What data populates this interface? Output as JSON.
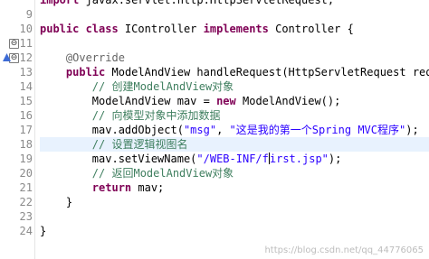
{
  "editor": {
    "line_numbers": [
      "9",
      "10",
      "11",
      "12",
      "13",
      "14",
      "15",
      "16",
      "17",
      "18",
      "19",
      "20",
      "21",
      "22",
      "23",
      "24"
    ],
    "lines": [
      [
        {
          "c": "kw",
          "t": "import"
        },
        {
          "c": "",
          "t": " javax.servlet.http.HttpServletRequest;"
        }
      ],
      [],
      [
        {
          "c": "kw",
          "t": "public class"
        },
        {
          "c": "",
          "t": " IController "
        },
        {
          "c": "kw",
          "t": "implements"
        },
        {
          "c": "",
          "t": " Controller {"
        }
      ],
      [],
      [
        {
          "c": "an",
          "t": "    @Override"
        }
      ],
      [
        {
          "c": "",
          "t": "    "
        },
        {
          "c": "kw",
          "t": "public"
        },
        {
          "c": "",
          "t": " ModelAndView handleRequest(HttpServletRequest request, H"
        }
      ],
      [
        {
          "c": "cm",
          "t": "        // 创建ModelAndView对象"
        }
      ],
      [
        {
          "c": "",
          "t": "        ModelAndView mav = "
        },
        {
          "c": "kw",
          "t": "new"
        },
        {
          "c": "",
          "t": " ModelAndView();"
        }
      ],
      [
        {
          "c": "cm",
          "t": "        // 向模型对象中添加数据"
        }
      ],
      [
        {
          "c": "",
          "t": "        mav.addObject("
        },
        {
          "c": "str",
          "t": "\"msg\""
        },
        {
          "c": "",
          "t": ", "
        },
        {
          "c": "str",
          "t": "\"这是我的第一个Spring MVC程序\""
        },
        {
          "c": "",
          "t": ");"
        }
      ],
      [
        {
          "c": "cm",
          "t": "        // 设置逻辑视图名"
        }
      ],
      [
        {
          "c": "",
          "t": "        mav.setViewName("
        },
        {
          "c": "str",
          "t": "\"/WEB-INF/f"
        },
        {
          "c": "cursor",
          "t": ""
        },
        {
          "c": "str",
          "t": "irst.jsp\""
        },
        {
          "c": "",
          "t": ");"
        }
      ],
      [
        {
          "c": "cm",
          "t": "        // 返回ModelAndView对象"
        }
      ],
      [
        {
          "c": "",
          "t": "        "
        },
        {
          "c": "kw",
          "t": "return"
        },
        {
          "c": "",
          "t": " mav;"
        }
      ],
      [
        {
          "c": "",
          "t": "    }"
        }
      ],
      [],
      [
        {
          "c": "",
          "t": "}"
        }
      ]
    ],
    "highlighted_line": "18",
    "fold_markers": {
      "11": "⊖",
      "12": "⊖"
    },
    "watermark": "https://blog.csdn.net/qq_44776065"
  }
}
